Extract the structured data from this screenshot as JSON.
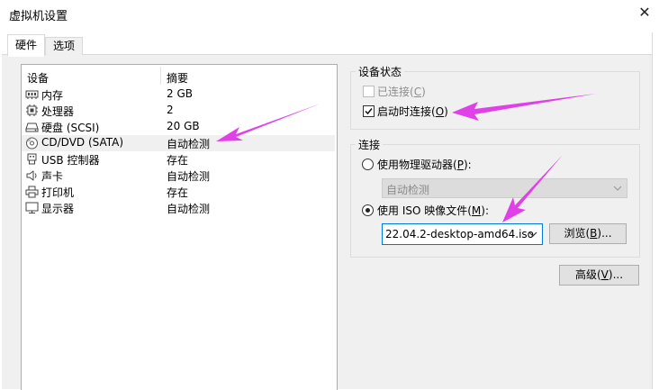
{
  "window": {
    "title": "虚拟机设置",
    "close_glyph": "✕"
  },
  "tabs": [
    {
      "label": "硬件"
    },
    {
      "label": "选项"
    }
  ],
  "device_list": {
    "columns": {
      "device": "设备",
      "summary": "摘要"
    },
    "rows": [
      {
        "name": "内存",
        "summary": "2 GB",
        "icon": "memory-icon"
      },
      {
        "name": "处理器",
        "summary": "2",
        "icon": "processor-icon"
      },
      {
        "name": "硬盘 (SCSI)",
        "summary": "20 GB",
        "icon": "hard-disk-icon"
      },
      {
        "name": "CD/DVD (SATA)",
        "summary": "自动检测",
        "icon": "cd-dvd-icon",
        "selected": true
      },
      {
        "name": "USB 控制器",
        "summary": "存在",
        "icon": "usb-icon"
      },
      {
        "name": "声卡",
        "summary": "自动检测",
        "icon": "speaker-icon"
      },
      {
        "name": "打印机",
        "summary": "存在",
        "icon": "printer-icon"
      },
      {
        "name": "显示器",
        "summary": "自动检测",
        "icon": "monitor-icon"
      }
    ]
  },
  "device_status": {
    "title": "设备状态",
    "connected": {
      "prefix": "已连接(",
      "key": "C",
      "suffix": ")",
      "checked": false,
      "enabled": false
    },
    "connect_at_power_on": {
      "prefix": "启动时连接(",
      "key": "O",
      "suffix": ")",
      "checked": true
    }
  },
  "connection": {
    "title": "连接",
    "physical": {
      "prefix": "使用物理驱动器(",
      "key": "P",
      "suffix": "):",
      "selected": false,
      "dropdown_value": "自动检测"
    },
    "iso": {
      "prefix": "使用 ISO 映像文件(",
      "key": "M",
      "suffix": "):",
      "selected": true,
      "path": "22.04.2-desktop-amd64.iso"
    },
    "browse": {
      "prefix": "浏览(",
      "key": "B",
      "suffix": ")..."
    }
  },
  "advanced": {
    "prefix": "高级(",
    "key": "V",
    "suffix": ")..."
  },
  "annotation_color": "#e040e8"
}
